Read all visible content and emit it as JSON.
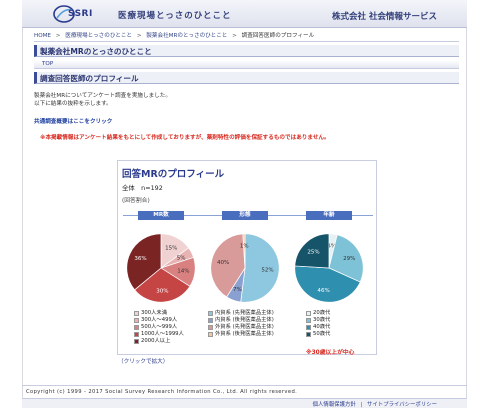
{
  "header": {
    "logo_text": "SSRI",
    "site_title": "医療現場とっさのひとこと",
    "company": "株式会社 社会情報サービス"
  },
  "breadcrumb": [
    {
      "label": "HOME"
    },
    {
      "label": "医療現場とっさのひとこと"
    },
    {
      "label": "製薬会社MRのとっさのひとこと"
    },
    {
      "label": "調査回答医師のプロフィール"
    }
  ],
  "sections": {
    "main_title": "製薬会社MRのとっさのひとこと",
    "top_link": "TOP",
    "profile_title": "調査回答医師のプロフィール"
  },
  "intro": {
    "line1": "製薬会社MRについてアンケート調査を実施しました。",
    "line2": "以下に結果の抜粋を示します。"
  },
  "survey_link": "共通調査概要はここをクリック",
  "notice": "※本掲載情報はアンケート結果をもとにして作成しておりますが、薬剤特性の評価を保証するものではありません。",
  "card": {
    "title": "回答MRのプロフィール",
    "n_label": "全体　n=192",
    "note": "(回答割合)",
    "highlight": "※30歳以上が中心"
  },
  "enlarge_link": "（クリックで拡大）",
  "footer": {
    "copyright": "Copyright (c) 1999 - 2017 Social Survey Research Information Co., Ltd. All rights reserved.",
    "link1": "個人情報保護方針",
    "link2": "サイトプライバシーポリシー"
  },
  "chart_data": [
    {
      "type": "pie",
      "title": "MR数",
      "labels": [
        "300人未満",
        "300人〜499人",
        "500人〜999人",
        "1000人〜1999人",
        "2000人以上"
      ],
      "values": [
        15,
        5,
        14,
        30,
        36
      ],
      "colors": [
        "#f1d2d2",
        "#e8b3b3",
        "#d98181",
        "#c54545",
        "#7a2424"
      ],
      "value_labels": [
        "15%",
        "5%",
        "14%",
        "30%",
        "36%"
      ]
    },
    {
      "type": "pie",
      "title": "形態",
      "labels": [
        "内資系 (先発医薬品主体)",
        "内資系 (後発医薬品主体)",
        "外資系 (先発医薬品主体)",
        "外資系 (後発医薬品主体)"
      ],
      "values": [
        52,
        7,
        40,
        1
      ],
      "colors": [
        "#8ec7e0",
        "#8aa0d0",
        "#d99a9a",
        "#f2c8a0"
      ],
      "value_labels": [
        "52%",
        "7%",
        "40%",
        "1%"
      ]
    },
    {
      "type": "pie",
      "title": "年齢",
      "labels": [
        "20歳代",
        "30歳代",
        "40歳代",
        "50歳代"
      ],
      "values": [
        4,
        29,
        46,
        25
      ],
      "colors": [
        "#e6f1f4",
        "#7ec2d8",
        "#2e8fae",
        "#16546a"
      ],
      "value_labels": [
        "4%",
        "29%",
        "46%",
        "25%"
      ]
    }
  ]
}
